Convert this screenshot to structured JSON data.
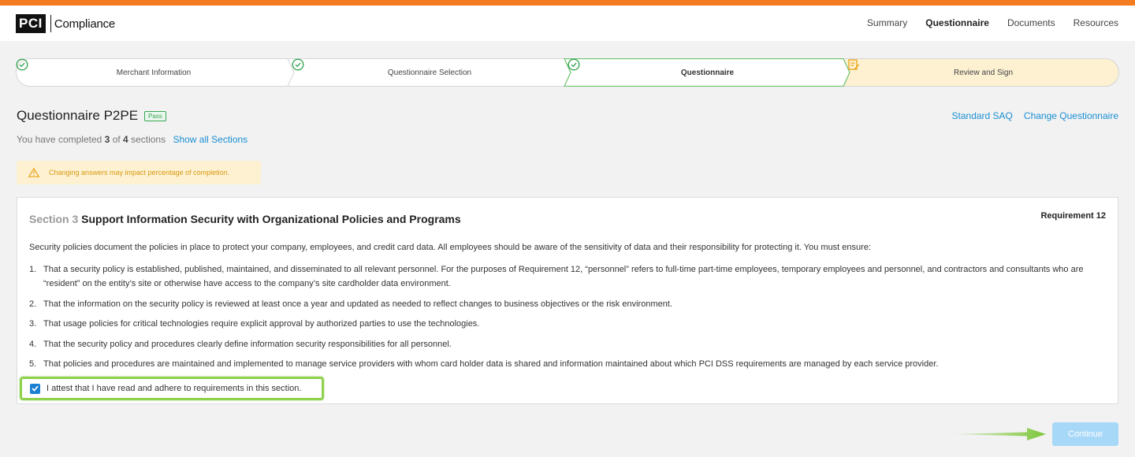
{
  "brand": {
    "logo_box": "PCI",
    "logo_text": "Compliance"
  },
  "nav": {
    "items": [
      "Summary",
      "Questionnaire",
      "Documents",
      "Resources"
    ],
    "active": "Questionnaire"
  },
  "stepper": {
    "steps": [
      {
        "label": "Merchant Information",
        "status": "complete"
      },
      {
        "label": "Questionnaire Selection",
        "status": "complete"
      },
      {
        "label": "Questionnaire",
        "status": "current"
      },
      {
        "label": "Review and Sign",
        "status": "upcoming"
      }
    ]
  },
  "header": {
    "title": "Questionnaire P2PE",
    "badge": "Pass",
    "links": {
      "standard_saq": "Standard SAQ",
      "change_questionnaire": "Change Questionnaire"
    },
    "completed_prefix": "You have completed",
    "completed_count": "3",
    "completed_of": "of",
    "completed_total": "4",
    "completed_suffix": "sections",
    "show_all": "Show all Sections"
  },
  "warning": {
    "text": "Changing answers may impact percentage of completion."
  },
  "section": {
    "number_label": "Section 3",
    "title": "Support Information Security with Organizational Policies and Programs",
    "requirement": "Requirement 12",
    "intro": "Security policies document the policies in place to protect your company, employees, and credit card data. All employees should be aware of the sensitivity of data and their responsibility for protecting it. You must ensure:",
    "items": [
      {
        "n": "1.",
        "text": "That a security policy is established, published, maintained, and disseminated to all relevant personnel. For the purposes of Requirement 12, “personnel” refers to full-time part-time employees, temporary employees and personnel, and contractors and consultants who are “resident” on the entity’s site or otherwise have access to the company’s site cardholder data environment."
      },
      {
        "n": "2.",
        "text": "That the information on the security policy is reviewed at least once a year and updated as needed to reflect changes to business objectives or the risk environment."
      },
      {
        "n": "3.",
        "text": "That usage policies for critical technologies require explicit approval by authorized parties to use the technologies."
      },
      {
        "n": "4.",
        "text": "That the security policy and procedures clearly define information security responsibilities for all personnel."
      },
      {
        "n": "5.",
        "text": "That policies and procedures are maintained and implemented to manage service providers with whom card holder data is shared and information maintained about which PCI DSS requirements are managed by each service provider."
      }
    ],
    "attest_label": "I attest that I have read and adhere to requirements in this section.",
    "attest_checked": true
  },
  "footer": {
    "continue_label": "Continue"
  },
  "colors": {
    "accent": "#f47b20",
    "link": "#1a8fd1",
    "success": "#3aa655",
    "highlight": "#8ed14a",
    "warning_bg": "#fdf1d2",
    "warning_text": "#d99a10"
  }
}
